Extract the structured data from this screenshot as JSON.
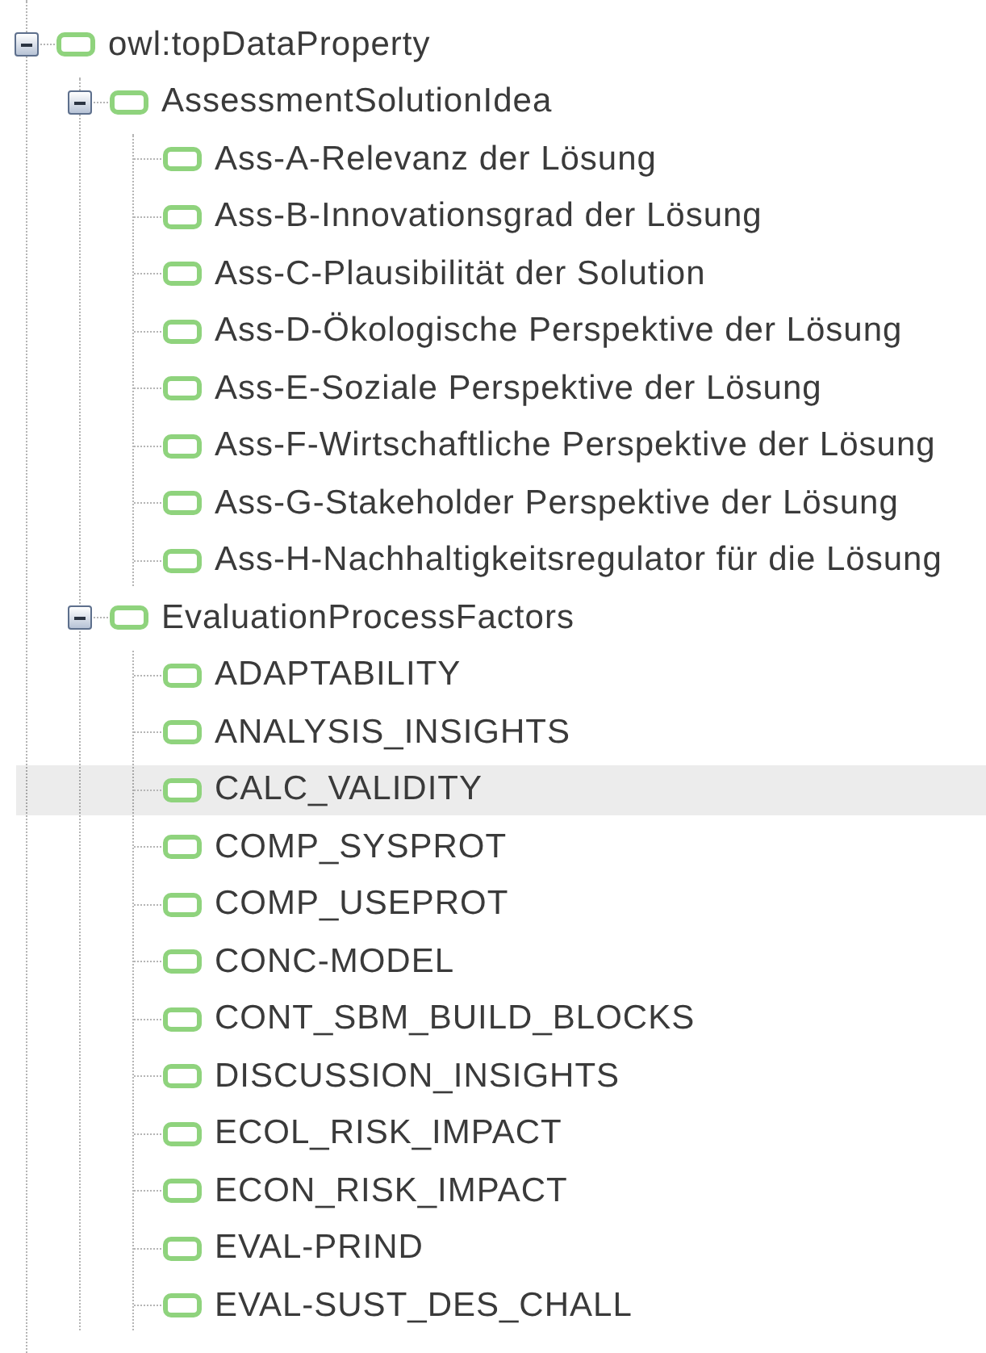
{
  "tree": [
    {
      "label": "owl:topDataProperty",
      "expanded": true,
      "selected": false,
      "children": [
        {
          "label": "AssessmentSolutionIdea",
          "expanded": true,
          "selected": false,
          "children": [
            {
              "label": "Ass-A-Relevanz der Lösung",
              "selected": false
            },
            {
              "label": "Ass-B-Innovationsgrad der Lösung",
              "selected": false
            },
            {
              "label": "Ass-C-Plausibilität der Solution",
              "selected": false
            },
            {
              "label": "Ass-D-Ökologische Perspektive der Lösung",
              "selected": false
            },
            {
              "label": "Ass-E-Soziale Perspektive der Lösung",
              "selected": false
            },
            {
              "label": "Ass-F-Wirtschaftliche Perspektive der Lösung",
              "selected": false
            },
            {
              "label": "Ass-G-Stakeholder Perspektive der Lösung",
              "selected": false
            },
            {
              "label": "Ass-H-Nachhaltigkeitsregulator für die Lösung",
              "selected": false
            }
          ]
        },
        {
          "label": "EvaluationProcessFactors",
          "expanded": true,
          "selected": false,
          "children": [
            {
              "label": "ADAPTABILITY",
              "selected": false
            },
            {
              "label": "ANALYSIS_INSIGHTS",
              "selected": false
            },
            {
              "label": "CALC_VALIDITY",
              "selected": true
            },
            {
              "label": "COMP_SYSPROT",
              "selected": false
            },
            {
              "label": "COMP_USEPROT",
              "selected": false
            },
            {
              "label": "CONC-MODEL",
              "selected": false
            },
            {
              "label": "CONT_SBM_BUILD_BLOCKS",
              "selected": false
            },
            {
              "label": "DISCUSSION_INSIGHTS",
              "selected": false
            },
            {
              "label": "ECOL_RISK_IMPACT",
              "selected": false
            },
            {
              "label": "ECON_RISK_IMPACT",
              "selected": false
            },
            {
              "label": "EVAL-PRIND",
              "selected": false
            },
            {
              "label": "EVAL-SUST_DES_CHALL",
              "selected": false
            }
          ]
        }
      ]
    }
  ]
}
